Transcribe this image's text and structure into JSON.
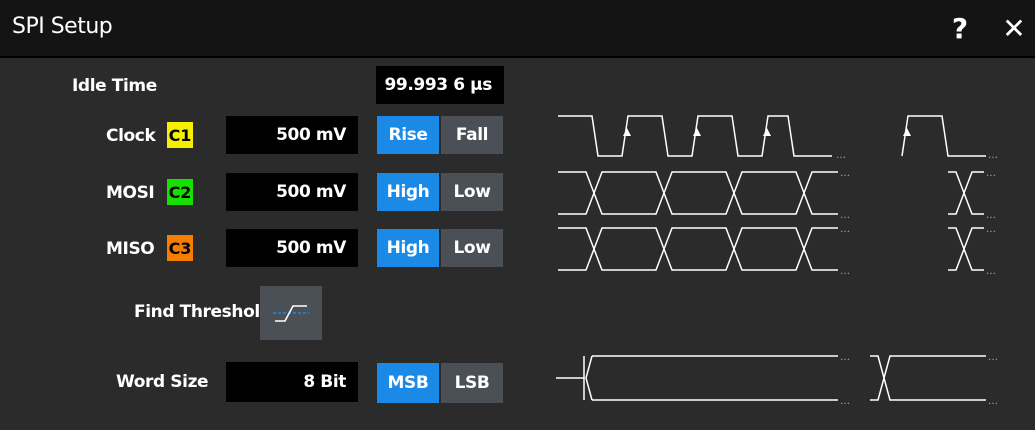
{
  "dialog": {
    "title": "SPI Setup",
    "help_icon": "question-mark-icon",
    "close_icon": "close-x-icon"
  },
  "idle_time": {
    "label": "Idle Time",
    "value": "99.993 6 µs"
  },
  "channels": [
    {
      "label": "Clock",
      "source": "C1",
      "source_color": "#f5f000",
      "threshold": "500 mV",
      "options": [
        "Rise",
        "Fall"
      ],
      "selected": "Rise"
    },
    {
      "label": "MOSI",
      "source": "C2",
      "source_color": "#17e000",
      "threshold": "500 mV",
      "options": [
        "High",
        "Low"
      ],
      "selected": "High"
    },
    {
      "label": "MISO",
      "source": "C3",
      "source_color": "#f57d00",
      "threshold": "500 mV",
      "options": [
        "High",
        "Low"
      ],
      "selected": "High"
    }
  ],
  "find_threshold": {
    "label": "Find Threshold",
    "icon": "find-threshold-icon"
  },
  "word_size": {
    "label": "Word Size",
    "value": "8 Bit",
    "options": [
      "MSB",
      "LSB"
    ],
    "selected": "MSB"
  },
  "colors": {
    "accent": "#1a8ae6",
    "button": "#4a5055",
    "panel": "#2b2b2b",
    "field": "#000000"
  }
}
